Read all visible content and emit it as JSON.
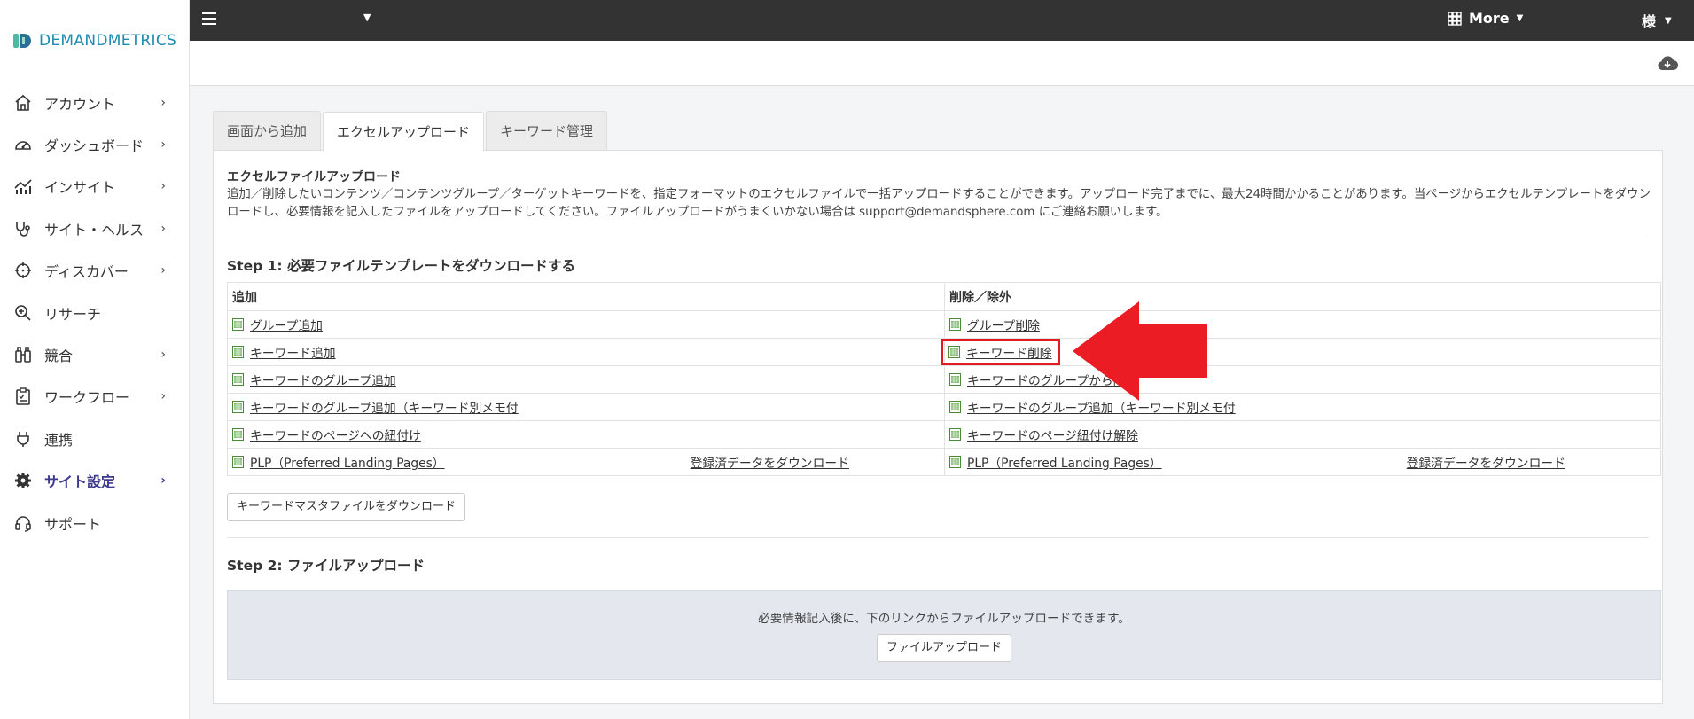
{
  "brand": {
    "name": "DEMANDMETRICS"
  },
  "sidebar": {
    "items": [
      {
        "label": "アカウント",
        "icon": "home-icon",
        "chevron": "›"
      },
      {
        "label": "ダッシュボード",
        "icon": "dashboard-gauge-icon",
        "chevron": "›"
      },
      {
        "label": "インサイト",
        "icon": "insight-chart-icon",
        "chevron": "›"
      },
      {
        "label": "サイト・ヘルス",
        "icon": "stethoscope-icon",
        "chevron": "›"
      },
      {
        "label": "ディスカバー",
        "icon": "crosshair-icon",
        "chevron": "›"
      },
      {
        "label": "リサーチ",
        "icon": "zoom-in-icon",
        "chevron": ""
      },
      {
        "label": "競合",
        "icon": "binoculars-icon",
        "chevron": "›"
      },
      {
        "label": "ワークフロー",
        "icon": "clipboard-icon",
        "chevron": "›"
      },
      {
        "label": "連携",
        "icon": "plug-icon",
        "chevron": ""
      },
      {
        "label": "サイト設定",
        "icon": "gear-icon",
        "chevron": "›"
      },
      {
        "label": "サポート",
        "icon": "headset-icon",
        "chevron": ""
      }
    ]
  },
  "topbar": {
    "more_label": "More",
    "user_label": "様"
  },
  "tabs": [
    {
      "label": "画面から追加"
    },
    {
      "label": "エクセルアップロード"
    },
    {
      "label": "キーワード管理"
    }
  ],
  "content": {
    "section_title": "エクセルファイルアップロード",
    "description": "追加／削除したいコンテンツ／コンテンツグループ／ターゲットキーワードを、指定フォーマットのエクセルファイルで一括アップロードすることができます。アップロード完了までに、最大24時間かかることがあります。当ページからエクセルテンプレートをダウンロードし、必要情報を記入したファイルをアップロードしてください。ファイルアップロードがうまくいかない場合は support@demandsphere.com にご連絡お願いします。",
    "step1_title": "Step 1: 必要ファイルテンプレートをダウンロードする",
    "table": {
      "col_add": "追加",
      "col_delete": "削除／除外",
      "rows": [
        {
          "add": "グループ追加",
          "delete": "グループ削除"
        },
        {
          "add": "キーワード追加",
          "delete": "キーワード削除"
        },
        {
          "add": "キーワードのグループ追加",
          "delete": "キーワードのグループから除外"
        },
        {
          "add": "キーワードのグループ追加（キーワード別メモ付",
          "delete": "キーワードのグループ追加（キーワード別メモ付"
        },
        {
          "add": "キーワードのページへの紐付け",
          "delete": "キーワードのページ紐付け解除"
        },
        {
          "add": "PLP（Preferred Landing Pages）",
          "add_extra": "登録済データをダウンロード",
          "delete": "PLP（Preferred Landing Pages）",
          "delete_extra": "登録済データをダウンロード"
        }
      ]
    },
    "master_button": "キーワードマスタファイルをダウンロード",
    "step2_title": "Step 2: ファイルアップロード",
    "upload_text": "必要情報記入後に、下のリンクからファイルアップロードできます。",
    "upload_button": "ファイルアップロード"
  },
  "colors": {
    "topbar": "#333333",
    "active_nav": "#3d3a8e",
    "brand": "#1f8ab3",
    "annotation": "#e01b24"
  }
}
